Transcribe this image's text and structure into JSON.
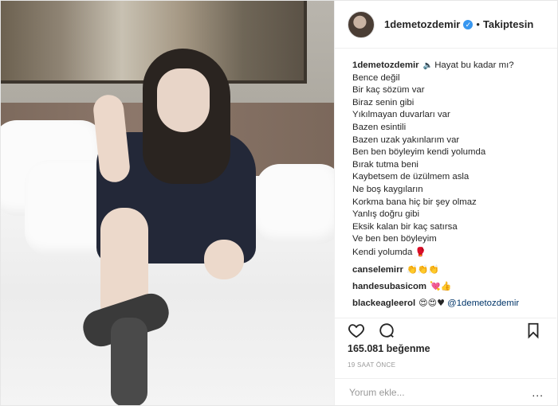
{
  "post": {
    "author": "1demetozdemir",
    "follow_status": "Takiptesin",
    "separator": "•",
    "verified_mark": "✓",
    "caption_first": "Hayat bu kadar mı?",
    "caption_lines": [
      "Bence değil",
      "Bir kaç sözüm var",
      "Biraz senin gibi",
      "Yıkılmayan duvarları var",
      "Bazen esintili",
      "Bazen uzak yakınlarım var",
      "Ben ben böyleyim kendi yolumda",
      "Bırak tutma beni",
      "Kaybetsem de üzülmem asla",
      "Ne boş kaygıların",
      "Korkma bana hiç bir şey olmaz",
      "Yanlış doğru gibi",
      "Eksik kalan bir kaç satırsa",
      "Ve ben ben böyleyim",
      "Kendi yolumda"
    ],
    "caption_speaker_emoji": "🔈",
    "caption_end_emoji": "🥊"
  },
  "comments": [
    {
      "user": "canselemirr",
      "text": "👏👏👏"
    },
    {
      "user": "handesubasicom",
      "text": "💘👍"
    },
    {
      "user": "blackeagleerol",
      "text": "😍😍♥",
      "mention": "@1demetozdemir"
    }
  ],
  "actions": {
    "like_icon": "heart-icon",
    "comment_icon": "comment-icon",
    "save_icon": "bookmark-icon"
  },
  "likes_text": "165.081 beğenme",
  "time_text": "19 SAAT ÖNCE",
  "comment_input": {
    "placeholder": "Yorum ekle...",
    "more": "..."
  },
  "colors": {
    "verified": "#3897f0",
    "mention": "#003569",
    "muted": "#999999",
    "text": "#262626"
  }
}
